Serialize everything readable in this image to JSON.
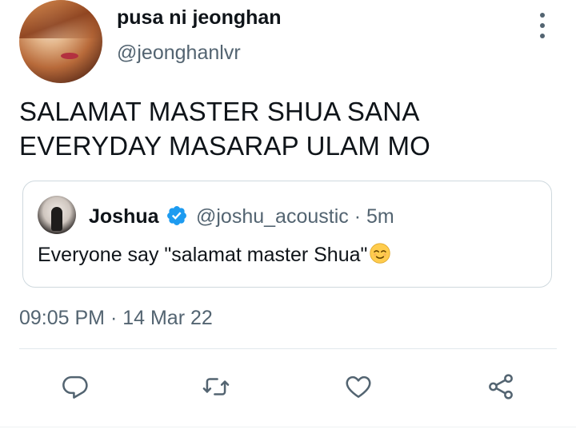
{
  "tweet": {
    "author": {
      "display_name": "pusa ni jeonghan",
      "handle": "@jeonghanlvr"
    },
    "text": "SALAMAT MASTER SHUA SANA EVERYDAY MASARAP ULAM MO",
    "timestamp": "09:05 PM · 14 Mar 22",
    "quoted": {
      "display_name": "Joshua",
      "verified": true,
      "handle_time": "@joshu_acoustic · 5m",
      "text": "Everyone say \"salamat master Shua\"",
      "emoji": "relieved-face"
    }
  },
  "icons": {
    "more": "more-vertical-icon",
    "reply": "reply-icon",
    "retweet": "retweet-icon",
    "like": "heart-icon",
    "share": "share-icon"
  },
  "colors": {
    "text": "#0f1419",
    "secondary": "#536471",
    "border": "#cfd9de",
    "verified": "#1d9bf0"
  }
}
